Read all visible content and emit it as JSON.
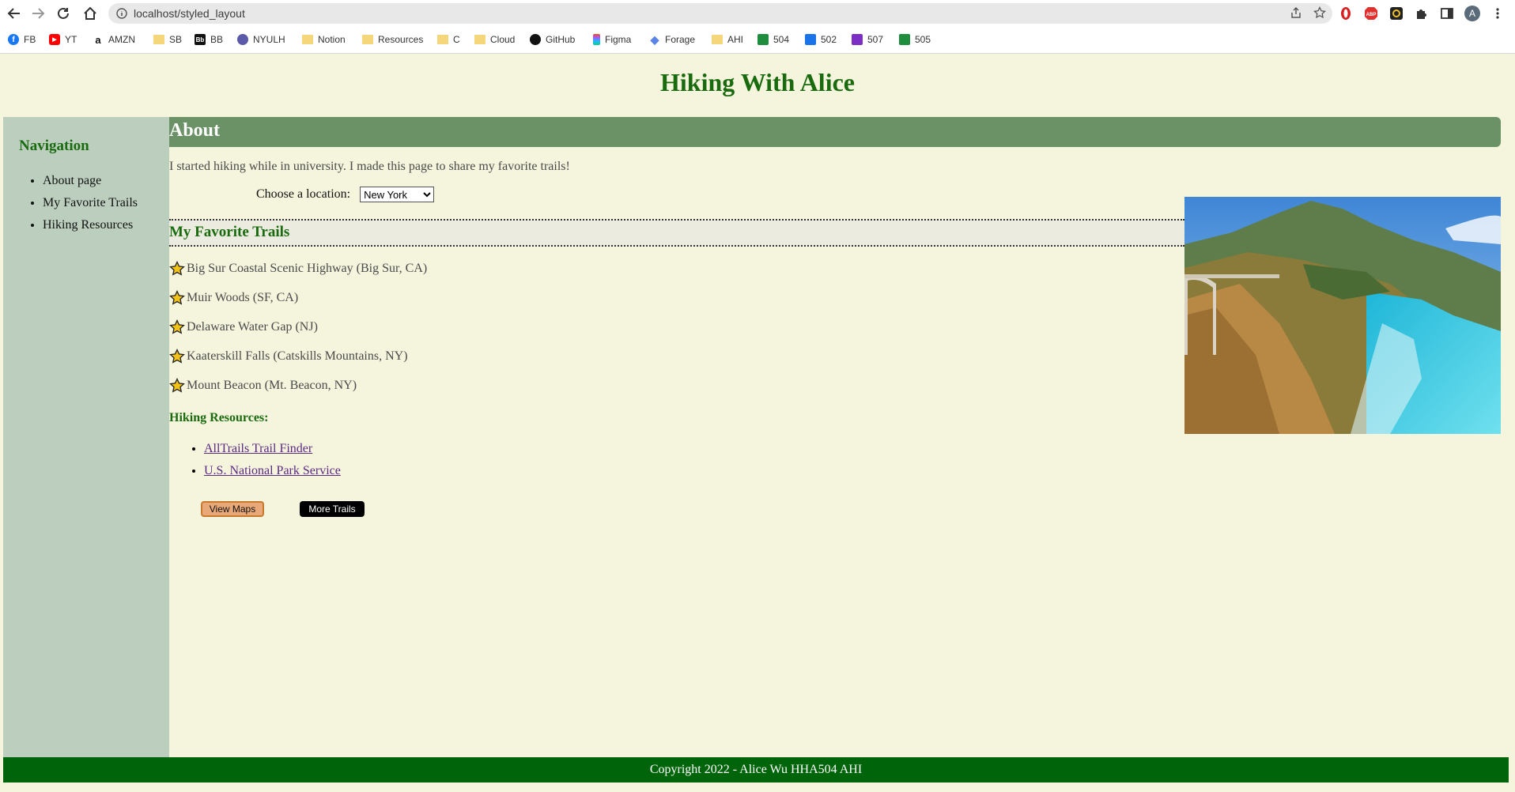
{
  "browser": {
    "url": "localhost/styled_layout",
    "profile_initial": "A",
    "bookmarks": [
      {
        "label": "FB",
        "icon": "facebook-icon"
      },
      {
        "label": "YT",
        "icon": "youtube-icon"
      },
      {
        "label": "AMZN",
        "icon": "amazon-icon"
      },
      {
        "label": "SB",
        "icon": "folder-icon"
      },
      {
        "label": "BB",
        "icon": "blackboard-icon"
      },
      {
        "label": "NYULH",
        "icon": "globe-icon"
      },
      {
        "label": "Notion",
        "icon": "folder-icon"
      },
      {
        "label": "Resources",
        "icon": "folder-icon"
      },
      {
        "label": "C",
        "icon": "folder-icon"
      },
      {
        "label": "Cloud",
        "icon": "folder-icon"
      },
      {
        "label": "GitHub",
        "icon": "github-icon"
      },
      {
        "label": "Figma",
        "icon": "figma-icon"
      },
      {
        "label": "Forage",
        "icon": "forage-icon"
      },
      {
        "label": "AHI",
        "icon": "folder-icon"
      },
      {
        "label": "504",
        "icon": "classroom-icon"
      },
      {
        "label": "502",
        "icon": "classroom-icon"
      },
      {
        "label": "507",
        "icon": "classroom-icon"
      },
      {
        "label": "505",
        "icon": "classroom-icon"
      }
    ]
  },
  "site": {
    "title": "Hiking With Alice"
  },
  "sidebar": {
    "heading": "Navigation",
    "items": [
      "About page",
      "My Favorite Trails",
      "Hiking Resources"
    ]
  },
  "about": {
    "heading": "About",
    "intro": "I started hiking while in university. I made this page to share my favorite trails!",
    "location_label": "Choose a location:",
    "location_selected": "New York"
  },
  "favorites": {
    "heading": "My Favorite Trails",
    "trails": [
      "Big Sur Coastal Scenic Highway (Big Sur, CA)",
      "Muir Woods (SF, CA)",
      "Delaware Water Gap (NJ)",
      "Kaaterskill Falls (Catskills Mountains, NY)",
      "Mount Beacon (Mt. Beacon, NY)"
    ]
  },
  "resources": {
    "heading": "Hiking Resources:",
    "links": [
      "AllTrails Trail Finder",
      "U.S. National Park Service"
    ]
  },
  "buttons": {
    "view_maps": "View Maps",
    "more_trails": "More Trails"
  },
  "footer": {
    "text": "Copyright 2022 - Alice Wu HHA504 AHI"
  },
  "colors": {
    "title_green": "#1a6b0f",
    "sidebar_bg": "#bccfbf",
    "about_bar": "#6a9266",
    "footer_bg": "#00640a",
    "page_bg": "#f5f4dc"
  }
}
